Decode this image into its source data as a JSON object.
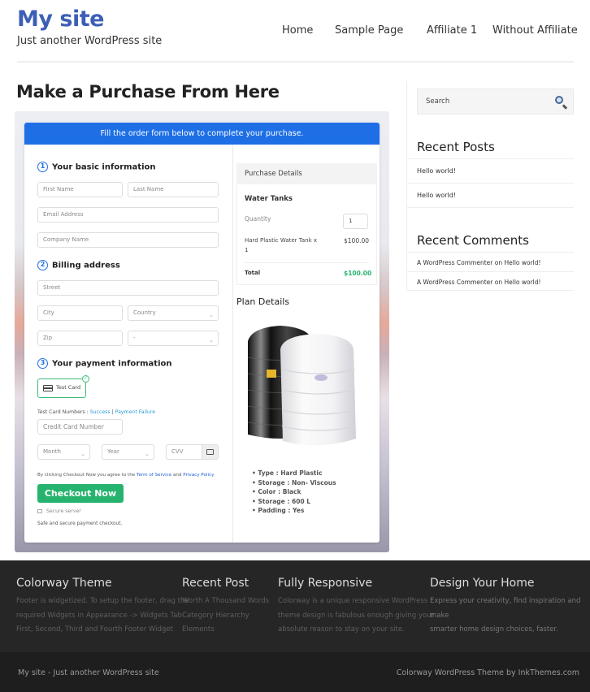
{
  "header": {
    "site_title": "My site",
    "tagline": "Just another WordPress site",
    "nav": [
      "Home",
      "Sample Page",
      "Affiliate 1",
      "Without Affiliate"
    ]
  },
  "page_title": "Make a Purchase From Here",
  "form": {
    "banner": "Fill the order form below to complete your purchase.",
    "section1": {
      "num": "1",
      "title": "Your basic information"
    },
    "section2": {
      "num": "2",
      "title": "Billing address"
    },
    "section3": {
      "num": "3",
      "title": "Your payment information"
    },
    "placeholders": {
      "first_name": "First Name",
      "last_name": "Last Name",
      "email": "Email Address",
      "company": "Company Name",
      "street": "Street",
      "city": "City",
      "country": "Country",
      "zip": "Zip",
      "state": "-",
      "credit_card": "Credit Card Number",
      "month": "Month",
      "year": "Year",
      "cvv": "CVV"
    },
    "test_card_label": "Test Card",
    "test_numbers_label": "Test Card Numbers :",
    "success_link": "Success",
    "separator": "|",
    "failure_link": "Payment Failure",
    "agree_prefix": "By clicking Checkout Now you agree to the",
    "terms_link": "Term of Service",
    "agree_and": "and",
    "privacy_link": "Privacy Policy",
    "checkout_button": "Checkout Now",
    "secure_server": "Secure server",
    "safe_text": "Safe and secure payment checkout."
  },
  "purchase": {
    "heading": "Purchase Details",
    "product_group": "Water Tanks",
    "quantity_label": "Quantity",
    "quantity_value": "1",
    "item_line1": "Hard Plastic Water Tank x",
    "item_line2": "1",
    "item_price": "$100.00",
    "total_label": "Total",
    "total_value": "$100.00",
    "total_color": "#26b36e"
  },
  "plan": {
    "heading": "Plan Details",
    "bullets": [
      "• Type : Hard Plastic",
      "• Storage : Non- Viscous",
      "• Color : Black",
      "• Storage : 600 L",
      "• Padding : Yes"
    ]
  },
  "sidebar": {
    "search_placeholder": "Search",
    "recent_posts_title": "Recent Posts",
    "recent_posts": [
      "Hello world!",
      "Hello world!"
    ],
    "recent_comments_title": "Recent Comments",
    "recent_comments": [
      {
        "author": "A WordPress Commenter",
        "on": "on",
        "post": "Hello world!"
      },
      {
        "author": "A WordPress Commenter",
        "on": "on",
        "post": "Hello world!"
      }
    ]
  },
  "footer": {
    "columns": [
      {
        "title": "Colorway Theme",
        "lines": [
          "Footer is widgetized. To setup the footer, drag the",
          "required Widgets in Appearance -> Widgets Tab",
          "First, Second, Third and Fourth Footer Widget"
        ]
      },
      {
        "title": "Recent Post",
        "lines": [
          "Worth A Thousand Words",
          "Category Hierarchy",
          "Elements"
        ]
      },
      {
        "title": "Fully Responsive",
        "lines": [
          "Colorway is a unique responsive WordPress",
          "theme design is fabulous enough giving your",
          "absolute reason to stay on your site."
        ]
      },
      {
        "title": "Design Your Home",
        "lines": [
          "Express your creativity, find inspiration and make",
          "smarter home design choices, faster."
        ]
      }
    ],
    "bottom_left": "My site - Just another WordPress site",
    "bottom_right": "Colorway WordPress Theme by InkThemes.com"
  },
  "colors": {
    "brand": "#3d5fb6",
    "banner": "#1e6fe6",
    "checkout": "#26b36e"
  }
}
